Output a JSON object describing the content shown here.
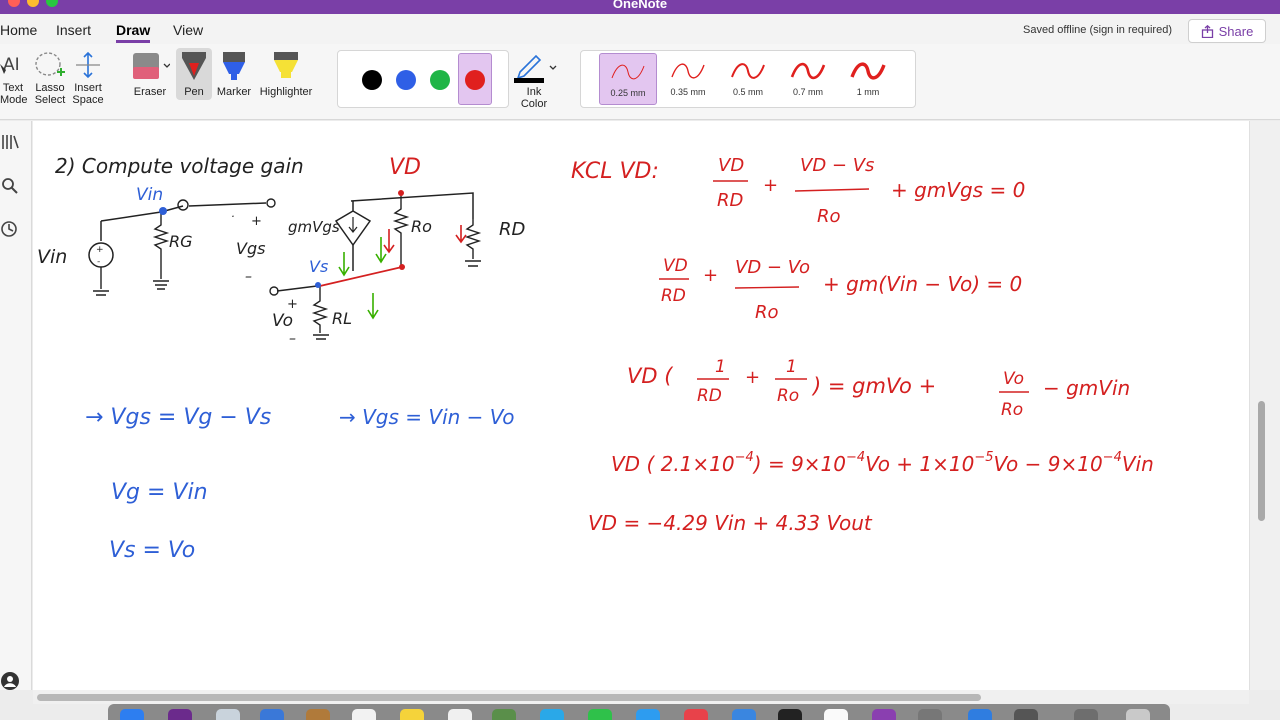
{
  "app": {
    "title": "OneNote"
  },
  "status": {
    "saved": "Saved offline (sign in required)"
  },
  "share": {
    "label": "Share"
  },
  "tabs": [
    {
      "label": "Home",
      "active": false
    },
    {
      "label": "Insert",
      "active": false
    },
    {
      "label": "Draw",
      "active": true
    },
    {
      "label": "View",
      "active": false
    }
  ],
  "tools": {
    "text_mode": [
      "Text",
      "Mode"
    ],
    "lasso_select": [
      "Lasso",
      "Select"
    ],
    "insert_space": [
      "Insert",
      "Space"
    ],
    "eraser": "Eraser",
    "pen": "Pen",
    "marker": "Marker",
    "highlighter": "Highlighter",
    "ink_color": [
      "Ink",
      "Color"
    ]
  },
  "colors": {
    "accent": "#7a3fa7",
    "ink_red": "#d42020",
    "ink_blue": "#2e5fd6",
    "ink_green": "#38b000",
    "swatches": [
      "#000000",
      "#2f5fe6",
      "#1fb546",
      "#e0201e"
    ],
    "selected_swatch": "#e0201e"
  },
  "thickness": [
    {
      "label": "0.25 mm",
      "selected": true
    },
    {
      "label": "0.35 mm",
      "selected": false
    },
    {
      "label": "0.5 mm",
      "selected": false
    },
    {
      "label": "0.7 mm",
      "selected": false
    },
    {
      "label": "1 mm",
      "selected": false
    }
  ],
  "notes": {
    "black": {
      "problem": "2) Compute voltage gain",
      "vin_source": "Vin",
      "rg": "RG",
      "vgs": "Vgs",
      "rd_load": "RD",
      "gmvgs": "gmVgs",
      "ro": "Ro",
      "rl": "RL",
      "vo": "Vo"
    },
    "blue": {
      "vin_node": "Vin",
      "vs_node": "Vs",
      "eq1": "→ Vgs = Vg − Vs",
      "eq2": "→ Vgs = Vin − Vo",
      "eq3": "Vg = Vin",
      "eq4": "Vs = Vo"
    },
    "red": {
      "vd_node": "VD",
      "kcl_label": "KCL VD:",
      "kcl_terms": [
        "VD",
        "RD",
        "VD − Vs",
        "Ro",
        "+ gmVgs = 0"
      ],
      "row2_terms": [
        "VD",
        "RD",
        "VD − Vo",
        "Ro",
        "+ gm(Vin − Vo) = 0"
      ],
      "row3_prefix": "VD (",
      "row3_fracs": [
        "1",
        "RD",
        "1",
        "Ro"
      ],
      "row3_right": [
        ") = gmVo +",
        "Vo",
        "Ro",
        "− gmVin"
      ],
      "row4": [
        "VD ( 2.1×10",
        "−4",
        ") = 9×10",
        "−4",
        "Vo + 1×10",
        "−5",
        "Vo − 9×10",
        "−4",
        "Vin"
      ],
      "row5": "VD = −4.29 Vin + 4.33 Vout"
    }
  }
}
